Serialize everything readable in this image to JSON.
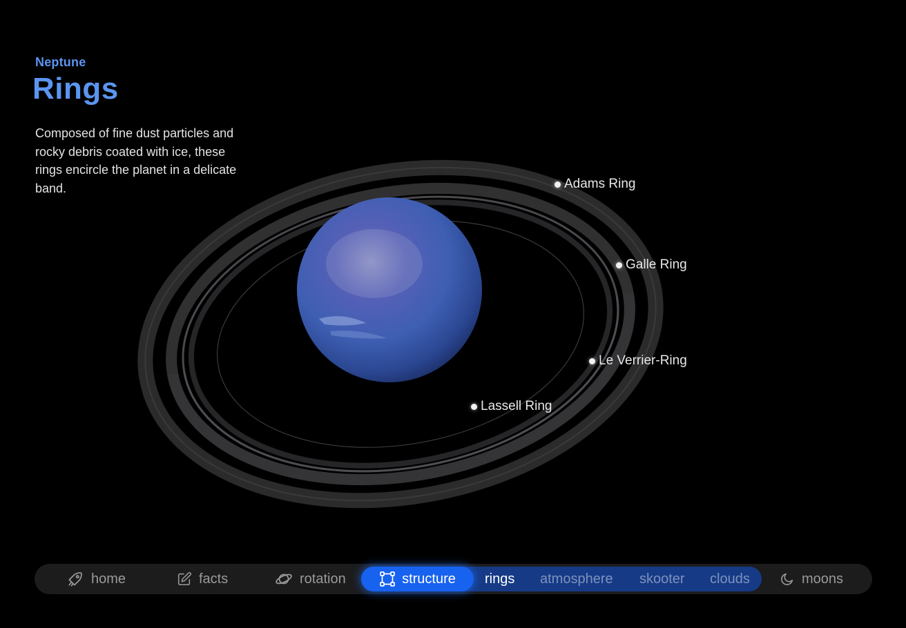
{
  "header": {
    "planet": "Neptune",
    "title": "Rings",
    "description": "Composed of fine dust particles and rocky debris coated with ice, these rings encircle the planet in a delicate band."
  },
  "ring_labels": {
    "adams": "Adams Ring",
    "galle": "Galle Ring",
    "le_verrier": "Le Verrier-Ring",
    "lassell": "Lassell Ring"
  },
  "nav": {
    "home": {
      "label": "home",
      "icon": "rocket-icon"
    },
    "facts": {
      "label": "facts",
      "icon": "edit-icon"
    },
    "rotation": {
      "label": "rotation",
      "icon": "planet-icon"
    },
    "structure": {
      "label": "structure",
      "icon": "structure-icon",
      "active": true
    },
    "rings": {
      "label": "rings",
      "active": true
    },
    "atmosphere": {
      "label": "atmosphere"
    },
    "skooter": {
      "label": "skooter"
    },
    "clouds": {
      "label": "clouds"
    },
    "moons": {
      "label": "moons",
      "icon": "moon-icon"
    }
  },
  "colors": {
    "accent": "#5b95f0",
    "active_pill": "#1762ee",
    "subgroup_bg": "#163a86",
    "nav_bg": "#1c1c1c",
    "background": "#000000"
  }
}
